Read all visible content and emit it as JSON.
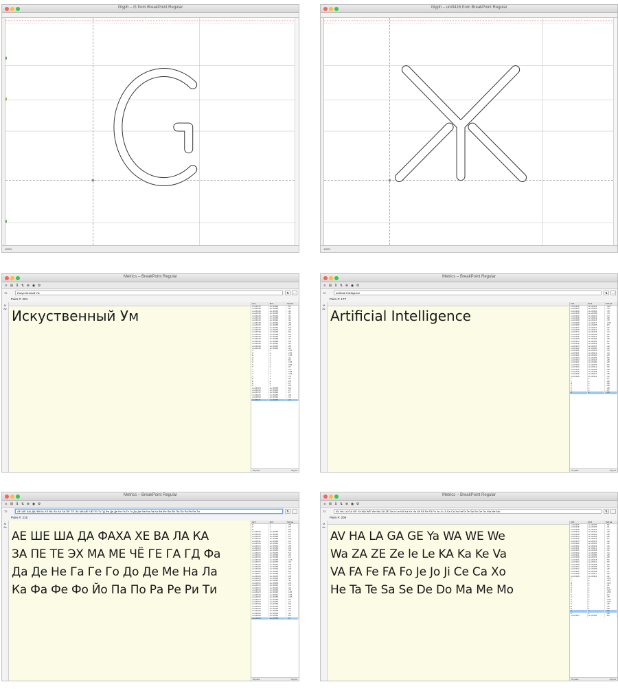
{
  "glyph_windows": [
    {
      "title": "Glyph – G from BreakPoint Regular",
      "zoom": "100%",
      "glyph": "G"
    },
    {
      "title": "Glyph – uni0416 from BreakPoint Regular",
      "zoom": "100%",
      "glyph": "Zhe"
    }
  ],
  "metrics_windows": [
    {
      "title": "Metrics – BreakPoint Regular",
      "size": "72",
      "text_field": "Искуственный Ум",
      "pairs_label": "Pairs #: 204",
      "preview_lines": [
        "Искуственный Ум"
      ],
      "kerning_header": [
        "1st",
        "2nd",
        "Value"
      ],
      "kerning_rows": [
        [
          "uni0433",
          "uni0442",
          "-97"
        ],
        [
          "uni0440",
          "uni0430",
          "-42"
        ],
        [
          "uni0440",
          "uni0435",
          "-42"
        ],
        [
          "uni0440",
          "uni043E",
          "-42"
        ],
        [
          "uni0440",
          "uni0441",
          "-41"
        ],
        [
          "uni0443",
          "uni0430",
          "-41"
        ],
        [
          "uni0443",
          "uni0441",
          "-41"
        ],
        [
          "uni0440",
          "uni0442",
          "-28"
        ],
        [
          "uni0442",
          "uni0430",
          "-28"
        ],
        [
          "uni0442",
          "uni0441",
          "-56"
        ],
        [
          "uni0444",
          "uni0434",
          "-28"
        ],
        [
          "uni0444",
          "uni0436",
          "-69"
        ],
        [
          "uni0444",
          "uni043B",
          "-56"
        ],
        [
          "uni0444",
          "uni0443",
          "-28"
        ],
        [
          "uni0445",
          "uni0448",
          "-41"
        ],
        [
          "uni0446",
          "uni0448",
          "-28"
        ],
        [
          "uni0446",
          "uni0447",
          "-41"
        ],
        [
          "uni0446",
          "uni0435",
          "-28"
        ],
        [
          "uni0440",
          "uni0442",
          "-42"
        ],
        [
          "Y",
          "o",
          "-167"
        ],
        [
          "Y",
          "e",
          "-167"
        ],
        [
          "W",
          "o",
          "-125"
        ],
        [
          "Z",
          "o",
          "-41"
        ],
        [
          "X",
          "o",
          "-83"
        ],
        [
          "X",
          "e",
          "-125"
        ],
        [
          "V",
          "o",
          "-209"
        ],
        [
          "T",
          "e",
          "-97"
        ],
        [
          "J",
          "o",
          "-70"
        ],
        [
          "J",
          "o",
          "-125"
        ],
        [
          "J",
          "o",
          "-125"
        ],
        [
          "J",
          "i",
          "-70"
        ],
        [
          "D",
          "o",
          "-42"
        ],
        [
          "D",
          "e",
          "-28"
        ],
        [
          "A",
          "o",
          "-27"
        ],
        [
          "O",
          "o",
          "-28"
        ],
        [
          "uni0423",
          "uni043E",
          "-84"
        ],
        [
          "uni0442",
          "uni0432",
          "-27"
        ],
        [
          "uni0432",
          "uni0442",
          "-27"
        ],
        [
          "uni0423",
          "uni0435",
          "-28"
        ],
        [
          "uni0418",
          "uni0441",
          "-14"
        ],
        [
          "uni0441",
          "uni0436",
          "-14"
        ]
      ],
      "kerning_footer": [
        "All pairs",
        "Glyphs"
      ]
    },
    {
      "title": "Metrics – BreakPoint Regular",
      "size": "72",
      "text_field": "Artificial Intelligence",
      "pairs_label": "Pairs #: 177",
      "preview_lines": [
        "Artificial Intelligence"
      ],
      "kerning_header": [
        "1st",
        "2nd",
        "Value"
      ],
      "kerning_rows": [
        [
          "uni0426",
          "uni0442",
          "-125"
        ],
        [
          "uni0424",
          "uni0436",
          "-70"
        ],
        [
          "uni0426",
          "uni0436",
          "-70"
        ],
        [
          "uni0430",
          "uni043B",
          "-70"
        ],
        [
          "uni0432",
          "uni0442",
          "-13"
        ],
        [
          "uni0430",
          "uni0442",
          "-28"
        ],
        [
          "uni0430",
          "uni0443",
          "-70"
        ],
        [
          "uni0430",
          "uni0447",
          "-138"
        ],
        [
          "uni0430",
          "uni043E",
          "-83"
        ],
        [
          "uni0433",
          "uni0441",
          "-42"
        ],
        [
          "uni0430",
          "uni0441",
          "-41"
        ],
        [
          "uni0434",
          "uni0433",
          "-14"
        ],
        [
          "uni0436",
          "uni043E",
          "-28"
        ],
        [
          "uni0436",
          "uni0441",
          "-56"
        ],
        [
          "uni0436",
          "uni0430",
          "-28"
        ],
        [
          "uni0433",
          "uni0430",
          "-97"
        ],
        [
          "uni0436",
          "uni0442",
          "-42"
        ],
        [
          "uni0433",
          "uni0433",
          "-42"
        ],
        [
          "uni0442",
          "uni043D",
          "-42"
        ],
        [
          "uni0441",
          "uni0435",
          "-14"
        ],
        [
          "uni0441",
          "uni0441",
          "-14"
        ],
        [
          "uni0441",
          "uni0430",
          "-28"
        ],
        [
          "uni0442",
          "uni0436",
          "-56"
        ],
        [
          "uni0444",
          "uni0434",
          "-28"
        ],
        [
          "uni0441",
          "uni043D",
          "-28"
        ],
        [
          "uni0442",
          "uni0435",
          "-56"
        ],
        [
          "uni0444",
          "uni0441",
          "-56"
        ],
        [
          "uni0446",
          "uni0448",
          "-28"
        ],
        [
          "uni0445",
          "uni0448",
          "-41"
        ],
        [
          "uni0446",
          "uni0447",
          "-28"
        ],
        [
          "uni0440",
          "uni0442",
          "-42"
        ],
        [
          "T",
          "e",
          "-97"
        ],
        [
          "Y",
          "o",
          "-28"
        ],
        [
          "W",
          "o",
          "-98"
        ],
        [
          "X",
          "o",
          "-28"
        ],
        [
          "V",
          "o",
          "-28"
        ],
        [
          "J",
          "o",
          "-27"
        ],
        [
          "D",
          "e",
          "-45"
        ]
      ],
      "kerning_footer": [
        "All pairs",
        "Glyphs"
      ]
    },
    {
      "title": "Metrics – BreakPoint Regular",
      "size": "72",
      "text_field": "АЕ ШЕ ША ДА ФАХА ХЕ ВА ЛА КА ЗА ПЕ ТЕ ЭХ МА МЕ ЧЁ ГЕ ГА ГД Фа Да Де Не Га Ге Го До Де Ме На Ла Ка Фа Фе Фо Йо Па По Ра Ре Ри Ти",
      "pairs_label": "Pairs #: 215",
      "preview_lines": [
        "АЕ ШЕ ША ДА ФАХА ХЕ ВА ЛА КА",
        "ЗА ПЕ ТЕ ЭХ МА МЕ ЧЁ ГЕ ГА ГД Фа",
        "Да Де Не Га Ге Го До Де Ме На Ла",
        "Ка Фа Фе Фо Йо Па По Ра Ре Ри Ти"
      ],
      "kerning_header": [
        "1st",
        "2nd",
        "Value"
      ],
      "kerning_rows": [
        [
          "D",
          "o",
          "-28"
        ],
        [
          "A",
          "o",
          "-27"
        ],
        [
          "O",
          "o",
          "-28"
        ],
        [
          "uni0423",
          "uni043E",
          "-84"
        ],
        [
          "uni0442",
          "uni0432",
          "-27"
        ],
        [
          "uni0432",
          "uni0442",
          "-27"
        ],
        [
          "uni0423",
          "uni0435",
          "-28"
        ],
        [
          "uni0441",
          "uni0436",
          "-14"
        ],
        [
          "uni0418",
          "uni0441",
          "-14"
        ],
        [
          "uni0413",
          "uni043A",
          "-28"
        ],
        [
          "uni0423",
          "uni0430",
          "-28"
        ],
        [
          "uni0413",
          "uni0430",
          "-42"
        ],
        [
          "uni0413",
          "uni0433",
          "-55"
        ],
        [
          "uni0416",
          "uni0430",
          "-42"
        ],
        [
          "uni0416",
          "uni0438",
          "-14"
        ],
        [
          "uni0418",
          "uni0430",
          "-113"
        ],
        [
          "uni0413",
          "uni0432",
          "-42"
        ],
        [
          "uni0426",
          "uni0431",
          "-28"
        ],
        [
          "uni0426",
          "uni0430",
          "-55"
        ],
        [
          "uni0420",
          "uni0432",
          "-28"
        ],
        [
          "uni0420",
          "uni0435",
          "-69"
        ],
        [
          "uni0427",
          "uni0430",
          "-14"
        ],
        [
          "uni0424",
          "uni0433",
          "-28"
        ],
        [
          "uni0423",
          "uni0432",
          "-42"
        ],
        [
          "uni0420",
          "uni0441",
          "-42"
        ],
        [
          "uni0415",
          "uni0432",
          "-28"
        ],
        [
          "uni0413",
          "uni0441",
          "-14"
        ],
        [
          "uni0413",
          "uni0432",
          "-42"
        ],
        [
          "uni0414",
          "uni0434",
          "-70"
        ],
        [
          "uni0423",
          "uni0443",
          "-125"
        ],
        [
          "uni0433",
          "uni0441",
          "-153"
        ],
        [
          "uni0433",
          "uni0435",
          "-153"
        ],
        [
          "uni0414",
          "uni0430",
          "-55"
        ],
        [
          "uni0432",
          "uni0433",
          "-14"
        ],
        [
          "uni0424",
          "uni0436",
          "-69"
        ],
        [
          "uni0424",
          "uni0435",
          "-28"
        ],
        [
          "uni0426",
          "uni0436",
          "-42"
        ],
        [
          "uni0429",
          "uni0430",
          "-14"
        ],
        [
          "uni0420",
          "uni0432",
          "-41"
        ],
        [
          "uni0420",
          "uni0436",
          "-83"
        ],
        [
          "uni0426",
          "uni0438",
          "-27"
        ]
      ],
      "kerning_footer": [
        "All pairs",
        "Glyphs"
      ]
    },
    {
      "title": "Metrics – BreakPoint Regular",
      "size": "72",
      "text_field": "AV HA LA GA GE Ya WA WE We Wa ZA ZE Ze le Le KA Ka Ke Va VA FA Fe FA Fo Je Jo Ji Ce Ca Xo HeTa Te Sa Se De Do Ma Me Mo",
      "pairs_label": "Pairs #: 208",
      "preview_lines": [
        "AV HA LA GA GE Ya WA WE We",
        "Wa ZA ZE Ze le Le KA Ka Ke Va",
        "VA FA Fe FA Fo Je Jo Ji Ce Ca Xo",
        "He Ta Te Sa Se De Do Ma Me Mo"
      ],
      "kerning_header": [
        "1st",
        "2nd",
        "Value"
      ],
      "kerning_rows": [
        [
          "uni0425",
          "uni0430",
          "-55"
        ],
        [
          "uni0426",
          "uni0435",
          "-41"
        ],
        [
          "uni0430",
          "uni0432",
          "-14"
        ],
        [
          "uni0434",
          "uni0433",
          "-28"
        ],
        [
          "uni0436",
          "uni0436",
          "-28"
        ],
        [
          "uni0434",
          "uni043E",
          "-28"
        ],
        [
          "uni0432",
          "uni0442",
          "-97"
        ],
        [
          "uni0433",
          "uni0433",
          "-42"
        ],
        [
          "uni0442",
          "uni0435",
          "-42"
        ],
        [
          "uni0441",
          "uni0442",
          "-42"
        ],
        [
          "uni0441",
          "uni0441",
          "-14"
        ],
        [
          "uni0441",
          "uni0430",
          "-41"
        ],
        [
          "uni0442",
          "uni0436",
          "-14"
        ],
        [
          "uni0441",
          "uni043D",
          "-28"
        ],
        [
          "uni0430",
          "uni0432",
          "-28"
        ],
        [
          "uni0441",
          "uni0443",
          "-56"
        ],
        [
          "uni0444",
          "uni0441",
          "-56"
        ],
        [
          "uni0446",
          "uni0448",
          "-28"
        ],
        [
          "uni0444",
          "uni0436",
          "-56"
        ],
        [
          "uni0444",
          "uni043E",
          "-28"
        ],
        [
          "uni0445",
          "uni0448",
          "-41"
        ],
        [
          "uni0446",
          "uni0447",
          "-28"
        ],
        [
          "uni0440",
          "uni0442",
          "-42"
        ],
        [
          "Y",
          "o",
          "-167"
        ],
        [
          "Y",
          "e",
          "-167"
        ],
        [
          "W",
          "o",
          "-125"
        ],
        [
          "Z",
          "o",
          "-41"
        ],
        [
          "X",
          "o",
          "-83"
        ],
        [
          "X",
          "e",
          "-125"
        ],
        [
          "V",
          "o",
          "-209"
        ],
        [
          "T",
          "e",
          "-97"
        ],
        [
          "J",
          "o",
          "-70"
        ],
        [
          "J",
          "o",
          "-125"
        ],
        [
          "J",
          "o",
          "-125"
        ],
        [
          "J",
          "i",
          "-70"
        ],
        [
          "D",
          "o",
          "-42"
        ],
        [
          "D",
          "e",
          "-28"
        ],
        [
          "A",
          "o",
          "-27"
        ],
        [
          "O",
          "o",
          "-28"
        ],
        [
          "uni0423",
          "uni043E",
          "-84"
        ]
      ],
      "kerning_footer": [
        "All pairs",
        "Glyphs"
      ]
    }
  ]
}
